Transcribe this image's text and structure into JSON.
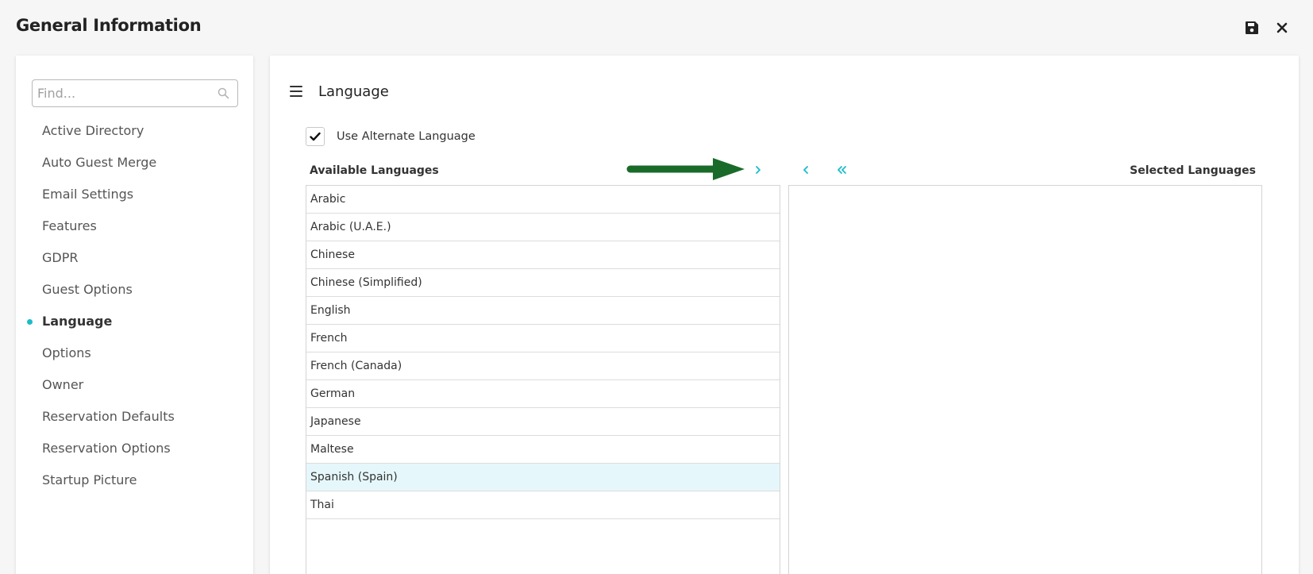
{
  "header": {
    "title": "General Information",
    "save_icon": "save-icon",
    "close_icon": "close-icon"
  },
  "sidebar": {
    "search": {
      "placeholder": "Find...",
      "value": "",
      "icon": "search-icon"
    },
    "items": [
      {
        "label": "Active Directory",
        "active": false
      },
      {
        "label": "Auto Guest Merge",
        "active": false
      },
      {
        "label": "Email Settings",
        "active": false
      },
      {
        "label": "Features",
        "active": false
      },
      {
        "label": "GDPR",
        "active": false
      },
      {
        "label": "Guest Options",
        "active": false
      },
      {
        "label": "Language",
        "active": true
      },
      {
        "label": "Options",
        "active": false
      },
      {
        "label": "Owner",
        "active": false
      },
      {
        "label": "Reservation Defaults",
        "active": false
      },
      {
        "label": "Reservation Options",
        "active": false
      },
      {
        "label": "Startup Picture",
        "active": false
      }
    ]
  },
  "main": {
    "menu_icon": "hamburger-menu-icon",
    "title": "Language",
    "use_alternate": {
      "label": "Use Alternate Language",
      "checked": true
    },
    "available_header": "Available Languages",
    "selected_header": "Selected Languages",
    "available_languages": [
      "Arabic",
      "Arabic (U.A.E.)",
      "Chinese",
      "Chinese (Simplified)",
      "English",
      "French",
      "French (Canada)",
      "German",
      "Japanese",
      "Maltese",
      "Spanish (Spain)",
      "Thai"
    ],
    "highlighted_language": "Spanish (Spain)",
    "selected_languages": [],
    "transfer_icons": [
      "move-right-icon",
      "move-left-icon",
      "move-all-left-icon"
    ]
  },
  "colors": {
    "accent": "#1bbcc9",
    "pointer_arrow": "#1a6b2a",
    "row_highlight": "#e6f7fb"
  }
}
